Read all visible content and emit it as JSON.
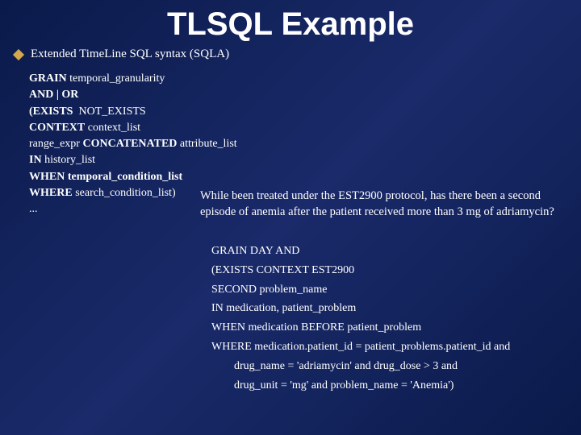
{
  "title": "TLSQL Example",
  "subtitle": "Extended TimeLine SQL syntax (SQLA)",
  "syntax": {
    "l1_kw": "GRAIN",
    "l1_rest": " temporal_granularity",
    "l2_kw": "AND | OR",
    "l3_kw": "(EXISTS",
    "l3_rest": "  NOT_EXISTS",
    "l4_kw": "CONTEXT",
    "l4_rest": " context_list",
    "l5_a": "range_expr ",
    "l5_kw": "CONCATENATED",
    "l5_b": " attribute_list",
    "l6_kw": "IN",
    "l6_rest": " history_list",
    "l7_kw": "WHEN temporal_condition_list",
    "l8_kw": "WHERE",
    "l8_rest": " search_condition_list)",
    "l9": "..."
  },
  "question": "While been treated under the EST2900 protocol, has there been a second episode of anemia after the patient received more than 3 mg of adriamycin?",
  "example": {
    "e1": "GRAIN DAY AND",
    "e2": "(EXISTS CONTEXT EST2900",
    "e3": "SECOND problem_name",
    "e4": "IN medication, patient_problem",
    "e5": "WHEN medication BEFORE patient_problem",
    "e6": "WHERE medication.patient_id = patient_problems.patient_id and",
    "e7": "drug_name = 'adriamycin' and drug_dose > 3 and",
    "e8": "drug_unit = 'mg' and problem_name = 'Anemia')"
  }
}
